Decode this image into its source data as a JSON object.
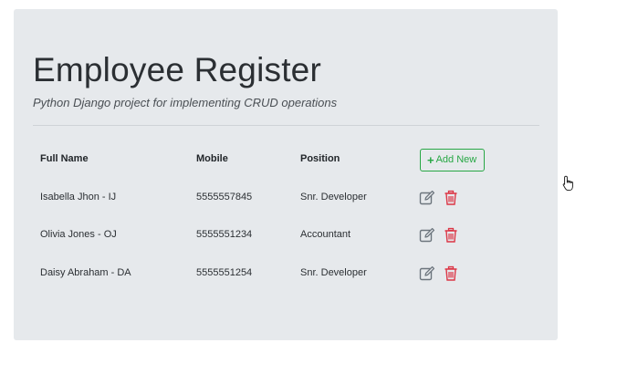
{
  "page": {
    "title": "Employee Register",
    "subtitle": "Python Django project for implementing CRUD operations"
  },
  "table": {
    "headers": {
      "full_name": "Full Name",
      "mobile": "Mobile",
      "position": "Position"
    },
    "add_button_label": "Add New",
    "rows": [
      {
        "full_name": "Isabella Jhon - IJ",
        "mobile": "5555557845",
        "position": "Snr. Developer"
      },
      {
        "full_name": "Olivia Jones - OJ",
        "mobile": "5555551234",
        "position": "Accountant"
      },
      {
        "full_name": "Daisy Abraham - DA",
        "mobile": "5555551254",
        "position": "Snr. Developer"
      }
    ]
  },
  "icons": {
    "add": "plus-icon",
    "edit": "edit-icon",
    "delete": "trash-icon",
    "cursor": "hand-pointer-cursor"
  },
  "colors": {
    "panel_background": "#e6e9ec",
    "add_button": "#28a745",
    "edit_icon": "#6c757d",
    "delete_icon": "#dc3545"
  }
}
